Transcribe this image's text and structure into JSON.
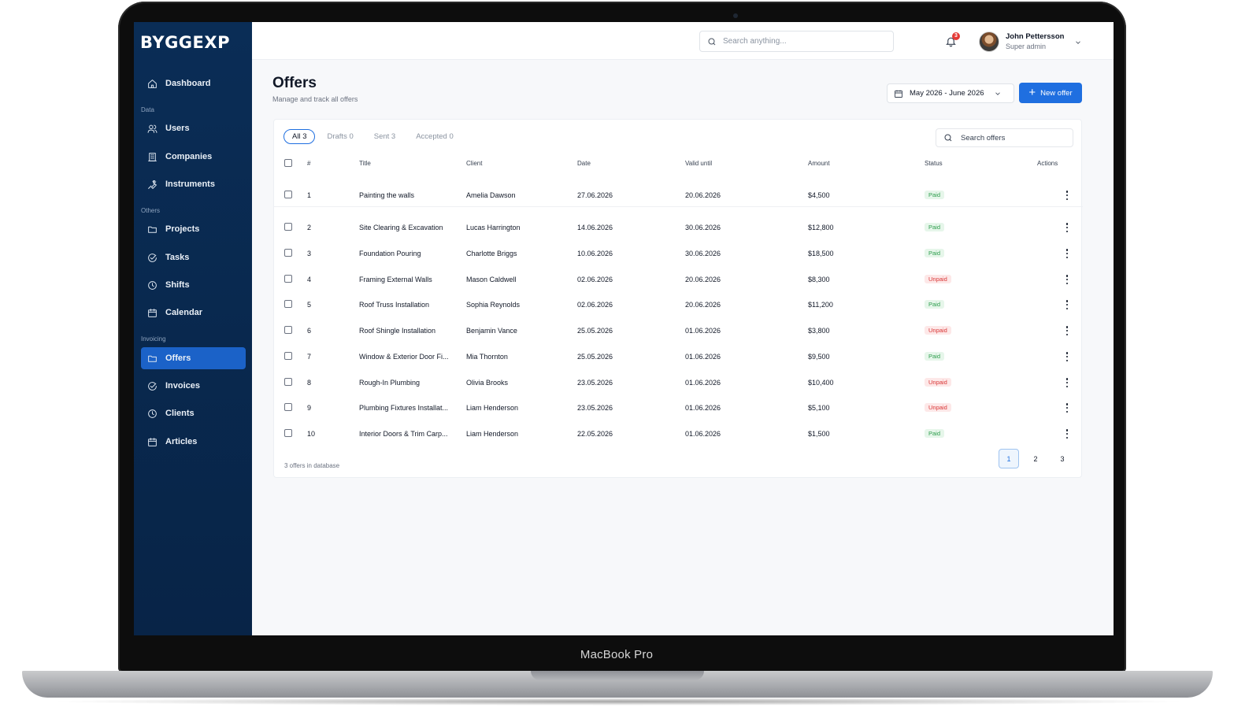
{
  "device": {
    "brand": "MacBook Pro"
  },
  "sidebar": {
    "logo": "BYGGEXP",
    "items": [
      {
        "label": "Dashboard",
        "icon": "home-icon"
      },
      {
        "section": "Data"
      },
      {
        "label": "Users",
        "icon": "users-icon"
      },
      {
        "label": "Companies",
        "icon": "building-icon"
      },
      {
        "label": "Instruments",
        "icon": "wrench-icon"
      },
      {
        "section": "Others"
      },
      {
        "label": "Projects",
        "icon": "folder-icon"
      },
      {
        "label": "Tasks",
        "icon": "check-circle-icon"
      },
      {
        "label": "Shifts",
        "icon": "clock-icon"
      },
      {
        "label": "Calendar",
        "icon": "calendar-icon"
      },
      {
        "section": "Invoicing"
      },
      {
        "label": "Offers",
        "icon": "folder-icon",
        "active": true
      },
      {
        "label": "Invoices",
        "icon": "check-circle-icon"
      },
      {
        "label": "Clients",
        "icon": "clock-icon"
      },
      {
        "label": "Articles",
        "icon": "calendar-icon"
      }
    ]
  },
  "topbar": {
    "search_placeholder": "Search anything...",
    "notification_count": "3",
    "user": {
      "name": "John Pettersson",
      "role": "Super admin"
    }
  },
  "header": {
    "title": "Offers",
    "subtitle": "Manage and track all offers",
    "date_range": "May 2026 - June 2026",
    "new_offer_label": "New offer"
  },
  "table": {
    "tabs": [
      {
        "label": "All 3",
        "active": true
      },
      {
        "label": "Drafts 0"
      },
      {
        "label": "Sent 3"
      },
      {
        "label": "Accepted 0"
      }
    ],
    "search_placeholder": "Search offers",
    "columns": [
      "#",
      "Title",
      "Client",
      "Date",
      "Valid until",
      "Amount",
      "Status",
      "Actions"
    ],
    "rows": [
      {
        "num": "1",
        "title": "Painting the walls",
        "client": "Amelia Dawson",
        "date": "27.06.2026",
        "valid": "20.06.2026",
        "amount": "$4,500",
        "status": "Paid"
      },
      {
        "num": "2",
        "title": "Site Clearing & Excavation",
        "client": "Lucas Harrington",
        "date": "14.06.2026",
        "valid": "30.06.2026",
        "amount": "$12,800",
        "status": "Paid"
      },
      {
        "num": "3",
        "title": "Foundation Pouring",
        "client": "Charlotte Briggs",
        "date": "10.06.2026",
        "valid": "30.06.2026",
        "amount": "$18,500",
        "status": "Paid"
      },
      {
        "num": "4",
        "title": "Framing External Walls",
        "client": "Mason Caldwell",
        "date": "02.06.2026",
        "valid": "20.06.2026",
        "amount": "$8,300",
        "status": "Unpaid"
      },
      {
        "num": "5",
        "title": "Roof Truss Installation",
        "client": "Sophia Reynolds",
        "date": "02.06.2026",
        "valid": "20.06.2026",
        "amount": "$11,200",
        "status": "Paid"
      },
      {
        "num": "6",
        "title": "Roof Shingle Installation",
        "client": "Benjamin Vance",
        "date": "25.05.2026",
        "valid": "01.06.2026",
        "amount": "$3,800",
        "status": "Unpaid"
      },
      {
        "num": "7",
        "title": "Window & Exterior Door Fi...",
        "client": "Mia Thornton",
        "date": "25.05.2026",
        "valid": "01.06.2026",
        "amount": "$9,500",
        "status": "Paid"
      },
      {
        "num": "8",
        "title": "Rough-In Plumbing",
        "client": "Olivia Brooks",
        "date": "23.05.2026",
        "valid": "01.06.2026",
        "amount": "$10,400",
        "status": "Unpaid"
      },
      {
        "num": "9",
        "title": "Plumbing Fixtures Installat...",
        "client": "Liam Henderson",
        "date": "23.05.2026",
        "valid": "01.06.2026",
        "amount": "$5,100",
        "status": "Unpaid"
      },
      {
        "num": "10",
        "title": "Interior Doors & Trim Carp...",
        "client": "Liam Henderson",
        "date": "22.05.2026",
        "valid": "01.06.2026",
        "amount": "$1,500",
        "status": "Paid"
      }
    ],
    "footer_note": "3 offers in database",
    "pages": [
      "1",
      "2",
      "3"
    ],
    "current_page": "1"
  },
  "colors": {
    "sidebar_bg": "#0a2d56",
    "accent": "#1f6fe0",
    "paid": "#2e9d4d",
    "unpaid": "#d93636"
  }
}
